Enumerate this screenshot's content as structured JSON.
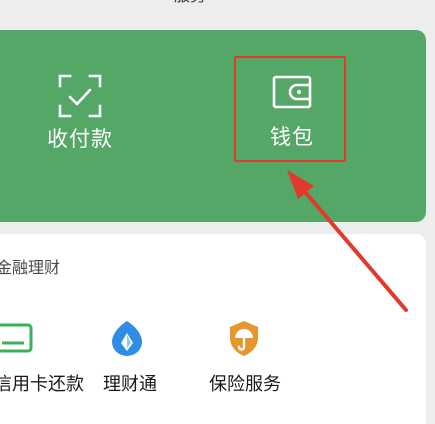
{
  "top": {
    "cut_title": "服务"
  },
  "payments": {
    "items": [
      {
        "label": "收付款",
        "icon": "scan-frame-icon"
      },
      {
        "label": "钱包",
        "icon": "wallet-icon"
      }
    ],
    "highlight_color": "#e23a2a",
    "accent_color": "#55a767"
  },
  "finance": {
    "title": "金融理财",
    "services": [
      {
        "label": "信用卡还款",
        "icon": "credit-card-icon",
        "color": "#3bb25a"
      },
      {
        "label": "理财通",
        "icon": "wealth-drop-icon",
        "color": "#2f8de4"
      },
      {
        "label": "保险服务",
        "icon": "umbrella-shield-icon",
        "color": "#e7962b"
      }
    ]
  }
}
